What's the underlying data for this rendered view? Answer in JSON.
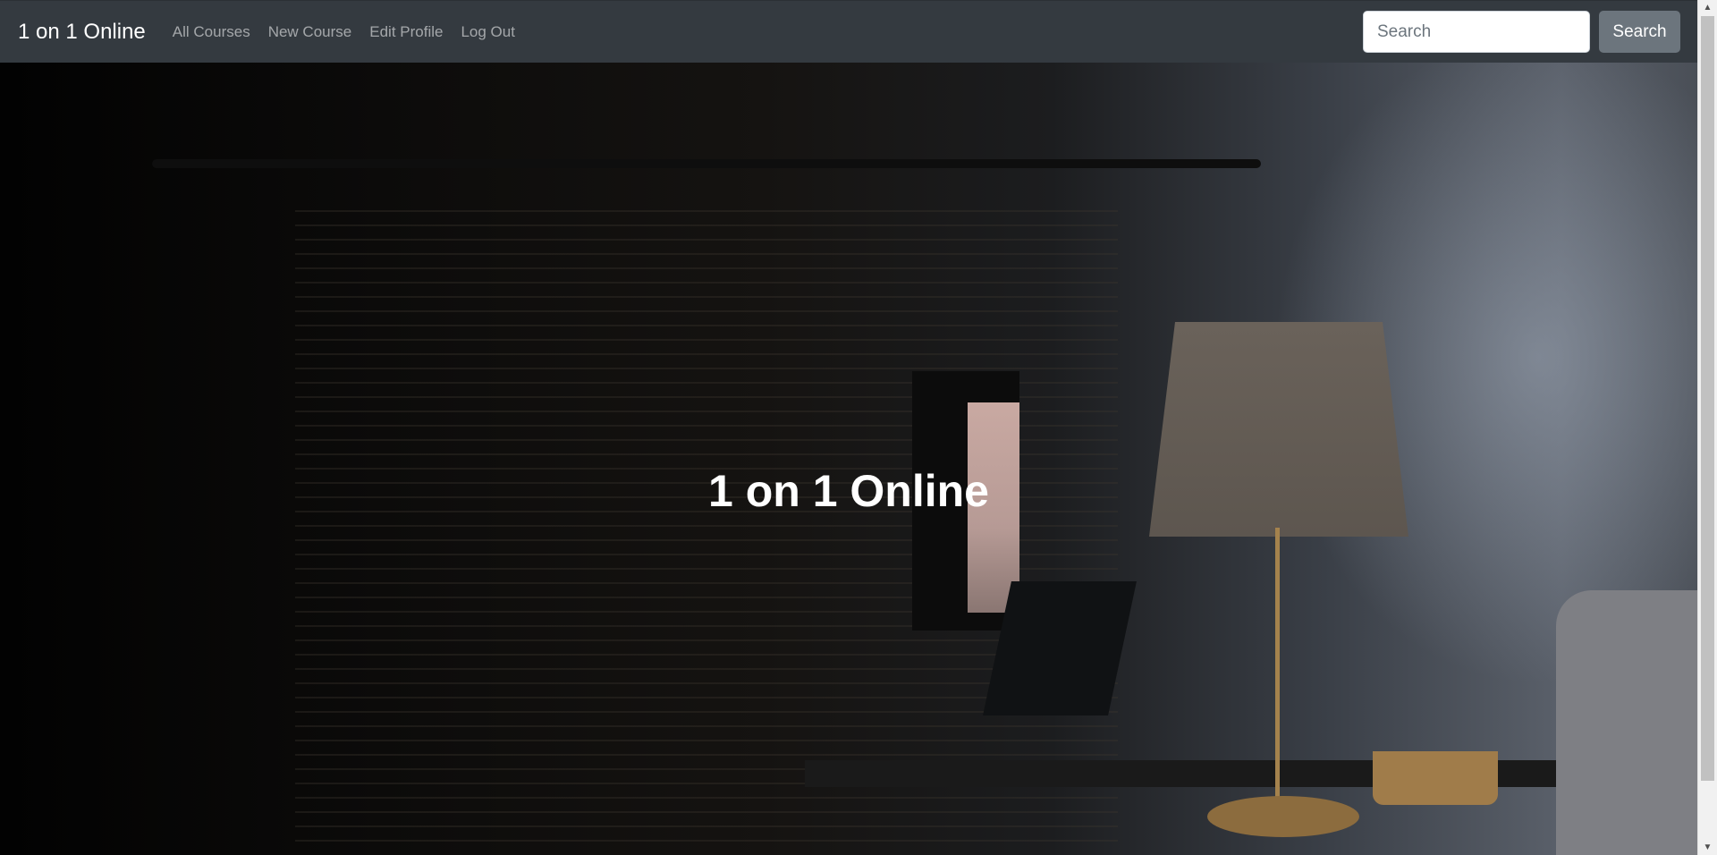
{
  "navbar": {
    "brand": "1 on 1 Online",
    "links": [
      {
        "label": "All Courses"
      },
      {
        "label": "New Course"
      },
      {
        "label": "Edit Profile"
      },
      {
        "label": "Log Out"
      }
    ],
    "search": {
      "placeholder": "Search",
      "value": "",
      "button_label": "Search"
    }
  },
  "hero": {
    "title": "1 on 1 Online"
  },
  "scrollbar": {
    "up_icon": "▲",
    "down_icon": "▼"
  },
  "colors": {
    "navbar_bg": "#343a40",
    "button_bg": "#6c757d",
    "link_color": "rgba(255,255,255,0.55)",
    "hero_text": "#ffffff"
  }
}
